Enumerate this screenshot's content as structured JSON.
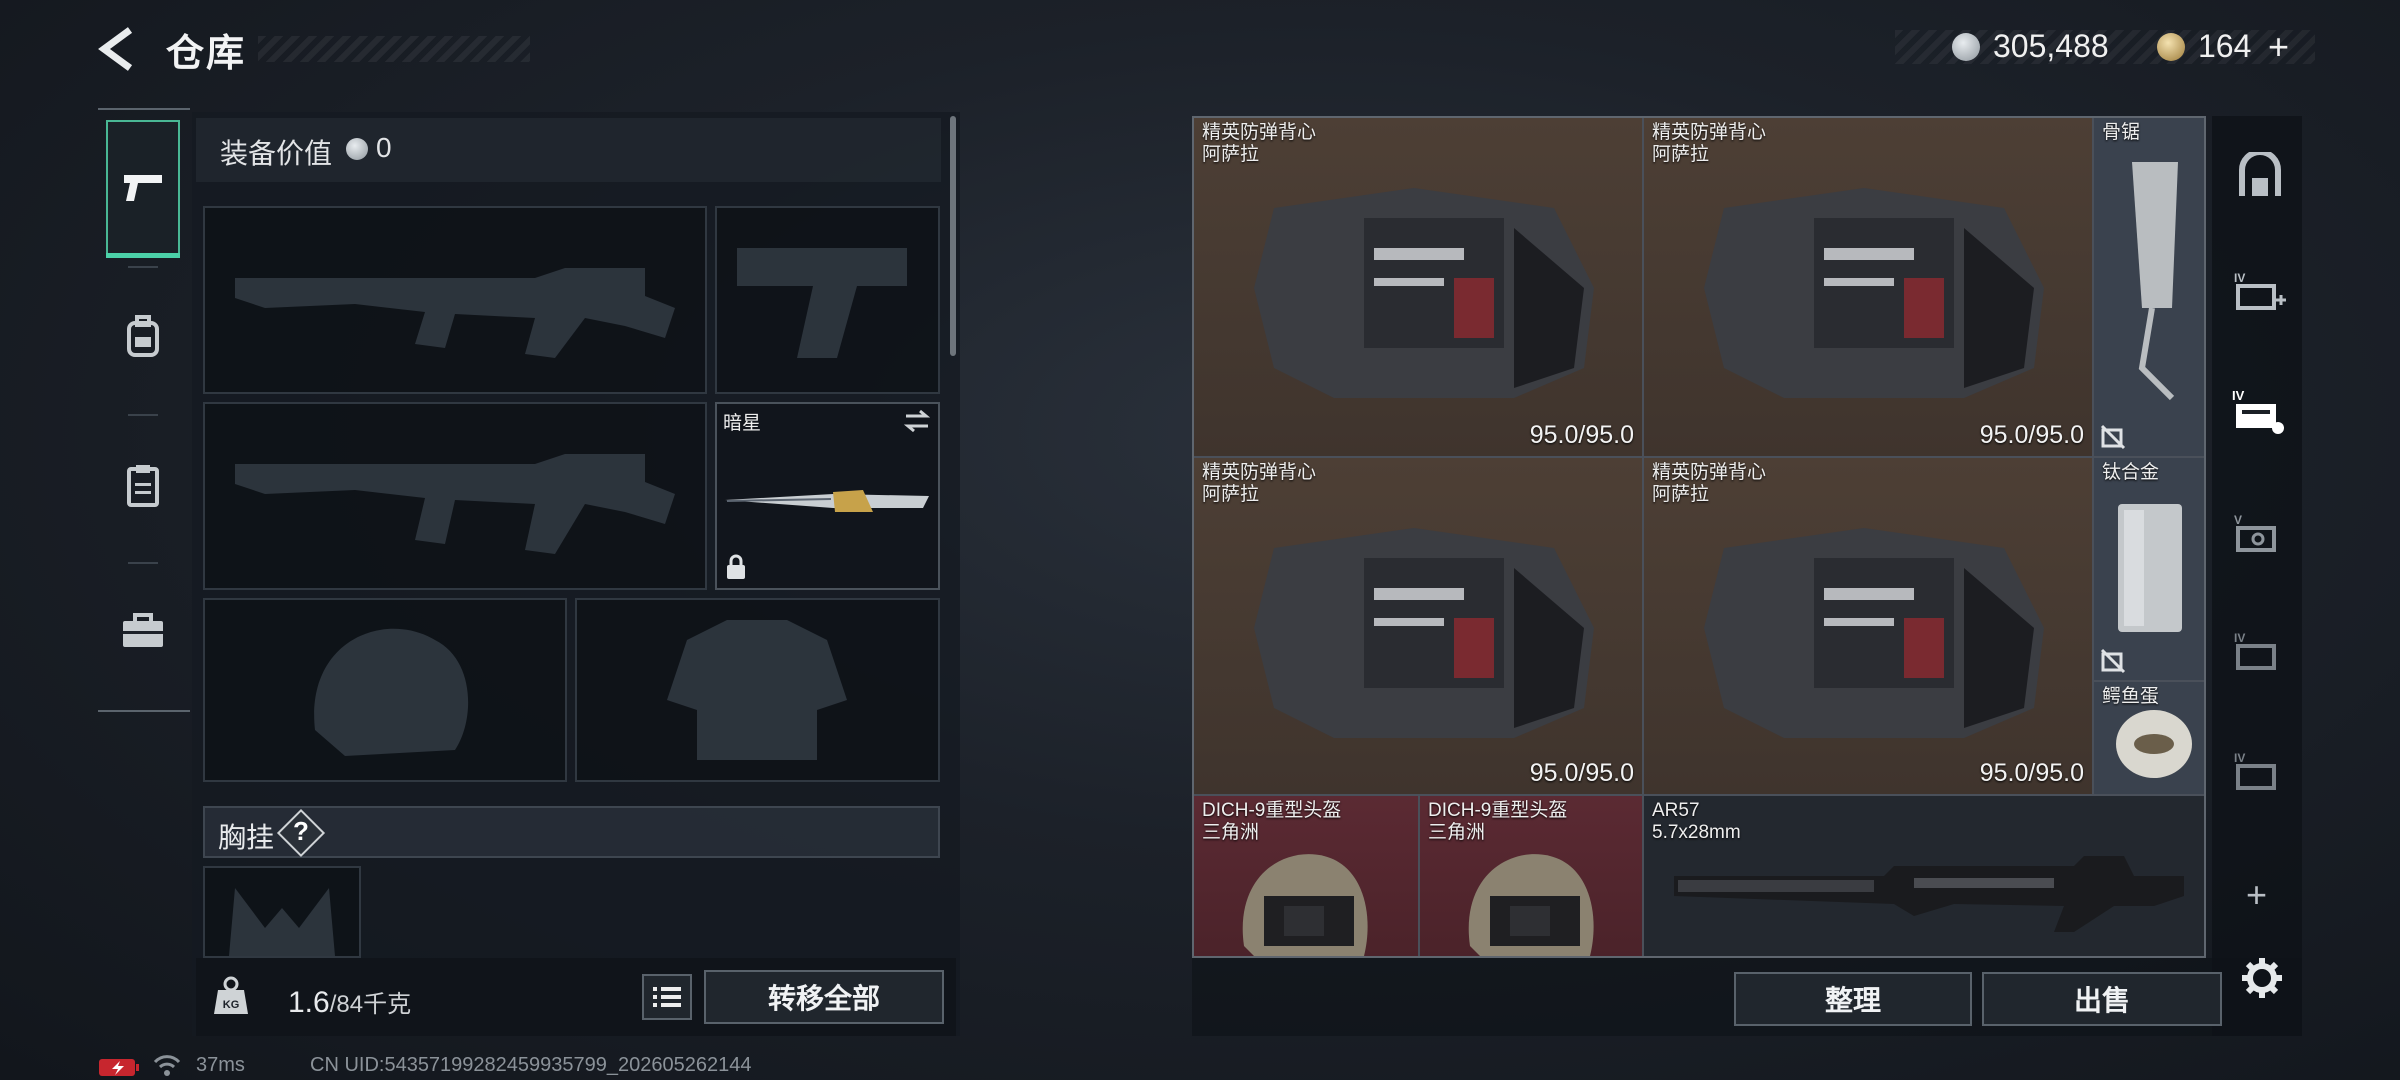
{
  "header": {
    "title": "仓库"
  },
  "currency": {
    "coins": "305,488",
    "tokens": "164",
    "plus": "+"
  },
  "left_tabs": [
    {
      "name": "weapons",
      "active": true
    },
    {
      "name": "backpack",
      "active": false
    },
    {
      "name": "clipboard",
      "active": false
    },
    {
      "name": "toolbox",
      "active": false
    }
  ],
  "equipment": {
    "value_label": "装备价值",
    "value": "0",
    "melee_name": "暗星",
    "chest_label": "胸挂",
    "chest_help": "?",
    "weight_current": "1.6",
    "weight_max": "/84千克",
    "transfer_all": "转移全部"
  },
  "stash": {
    "items": [
      {
        "name": "精英防弹背心",
        "sub": "阿萨拉",
        "durability": "95.0/95.0"
      },
      {
        "name": "精英防弹背心",
        "sub": "阿萨拉",
        "durability": "95.0/95.0"
      },
      {
        "name": "骨锯"
      },
      {
        "name": "精英防弹背心",
        "sub": "阿萨拉",
        "durability": "95.0/95.0"
      },
      {
        "name": "精英防弹背心",
        "sub": "阿萨拉",
        "durability": "95.0/95.0"
      },
      {
        "name": "钛合金"
      },
      {
        "name": "鳄鱼蛋"
      },
      {
        "name": "DICH-9重型头盔",
        "sub": "三角洲"
      },
      {
        "name": "DICH-9重型头盔",
        "sub": "三角洲"
      },
      {
        "name": "AR57",
        "sub": "5.7x28mm"
      }
    ],
    "sort_button": "整理",
    "sell_button": "出售"
  },
  "right_sidebar": {
    "add": "+"
  },
  "status_bar": {
    "ping": "37ms",
    "uid": "CN UID:5435719928245993579​9_202605262144"
  },
  "colors": {
    "accent": "#4bd1a8",
    "brown_cell": "#4d3f35",
    "red_cell": "#5b2a33"
  }
}
